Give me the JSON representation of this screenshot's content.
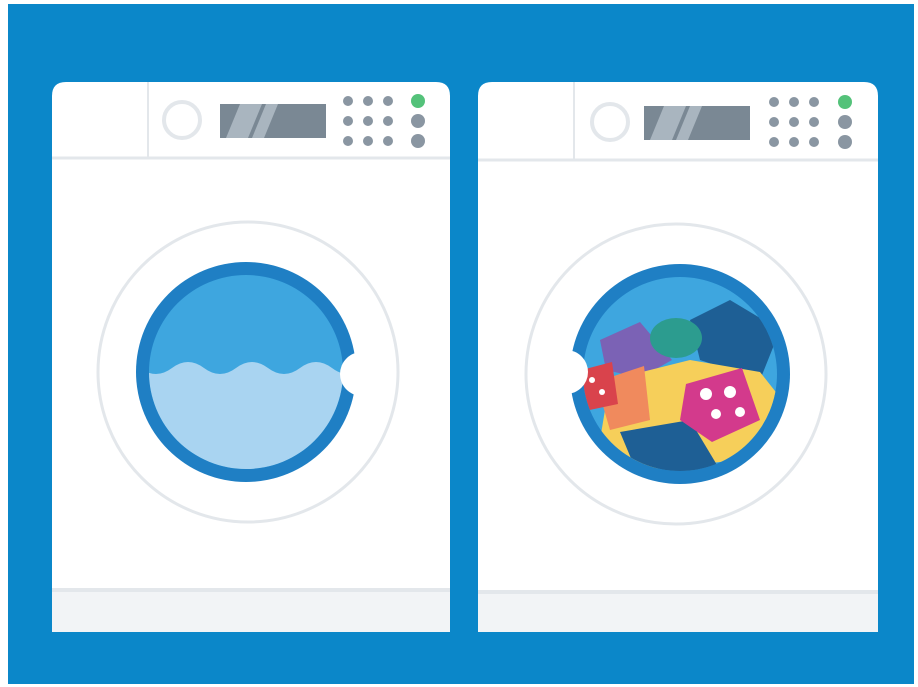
{
  "colors": {
    "background": "#0b87c9",
    "machine_body": "#ffffff",
    "machine_shade": "#f2f4f6",
    "seam": "#e3e7eb",
    "display": "#7a8894",
    "display_glare": "#a9b5bf",
    "button_grey": "#8a96a2",
    "power_green": "#54c27a",
    "drum_dark_blue": "#1f7fc4",
    "drum_blue": "#3ea6df",
    "water_light": "#a9d4f1",
    "laundry_yellow": "#f6cf5a",
    "laundry_orange": "#f08a5d",
    "laundry_red": "#d9434c",
    "laundry_magenta": "#d33a8c",
    "laundry_teal": "#2c9c8f",
    "laundry_navy": "#1e5f95",
    "laundry_purple": "#7b62b5"
  },
  "machines": [
    {
      "name": "washing-machine-water",
      "drum_contents": "water",
      "buttons": 9,
      "status_lights": [
        "power-on",
        "off",
        "off"
      ]
    },
    {
      "name": "washing-machine-laundry",
      "drum_contents": "laundry",
      "buttons": 9,
      "status_lights": [
        "power-on",
        "off",
        "off"
      ]
    }
  ]
}
